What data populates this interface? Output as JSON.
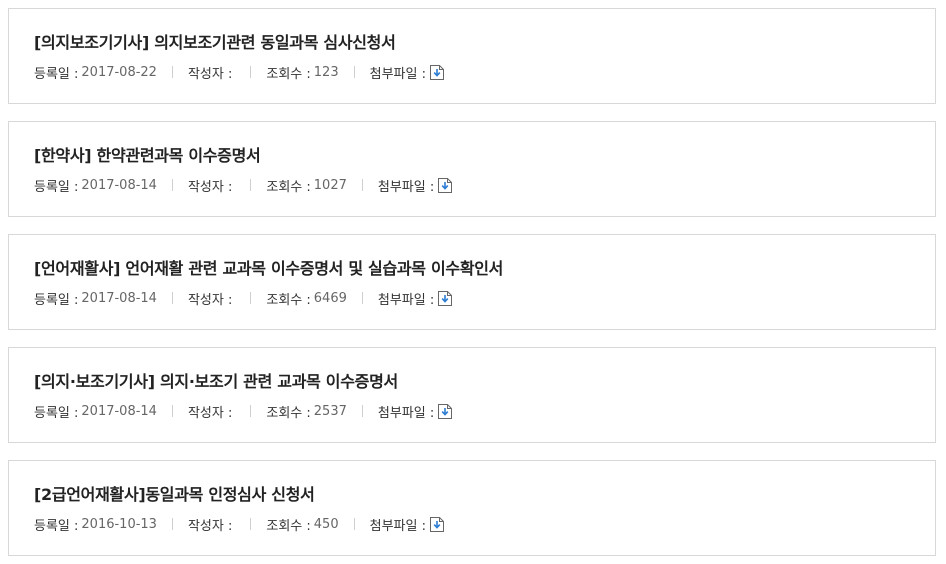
{
  "labels": {
    "date": "등록일 :",
    "author": "작성자 :",
    "views": "조회수 :",
    "attachment": "첨부파일 :"
  },
  "posts": [
    {
      "title": "[의지보조기기사] 의지보조기관련 동일과목 심사신청서",
      "date": "2017-08-22",
      "author": "",
      "views": "123",
      "attachment_icon": "file-download-icon"
    },
    {
      "title": "[한약사] 한약관련과목 이수증명서",
      "date": "2017-08-14",
      "author": "",
      "views": "1027",
      "attachment_icon": "file-download-icon"
    },
    {
      "title": "[언어재활사] 언어재활 관련 교과목 이수증명서 및 실습과목 이수확인서",
      "date": "2017-08-14",
      "author": "",
      "views": "6469",
      "attachment_icon": "file-download-icon"
    },
    {
      "title": "[의지·보조기기사] 의지·보조기 관련 교과목 이수증명서",
      "date": "2017-08-14",
      "author": "",
      "views": "2537",
      "attachment_icon": "file-download-icon"
    },
    {
      "title": "[2급언어재활사]동일과목 인정심사 신청서",
      "date": "2016-10-13",
      "author": "",
      "views": "450",
      "attachment_icon": "file-download-icon"
    }
  ],
  "colors": {
    "border": "#d8d8d8",
    "title": "#222222",
    "value": "#666666",
    "icon_accent": "#2b7cd3"
  }
}
